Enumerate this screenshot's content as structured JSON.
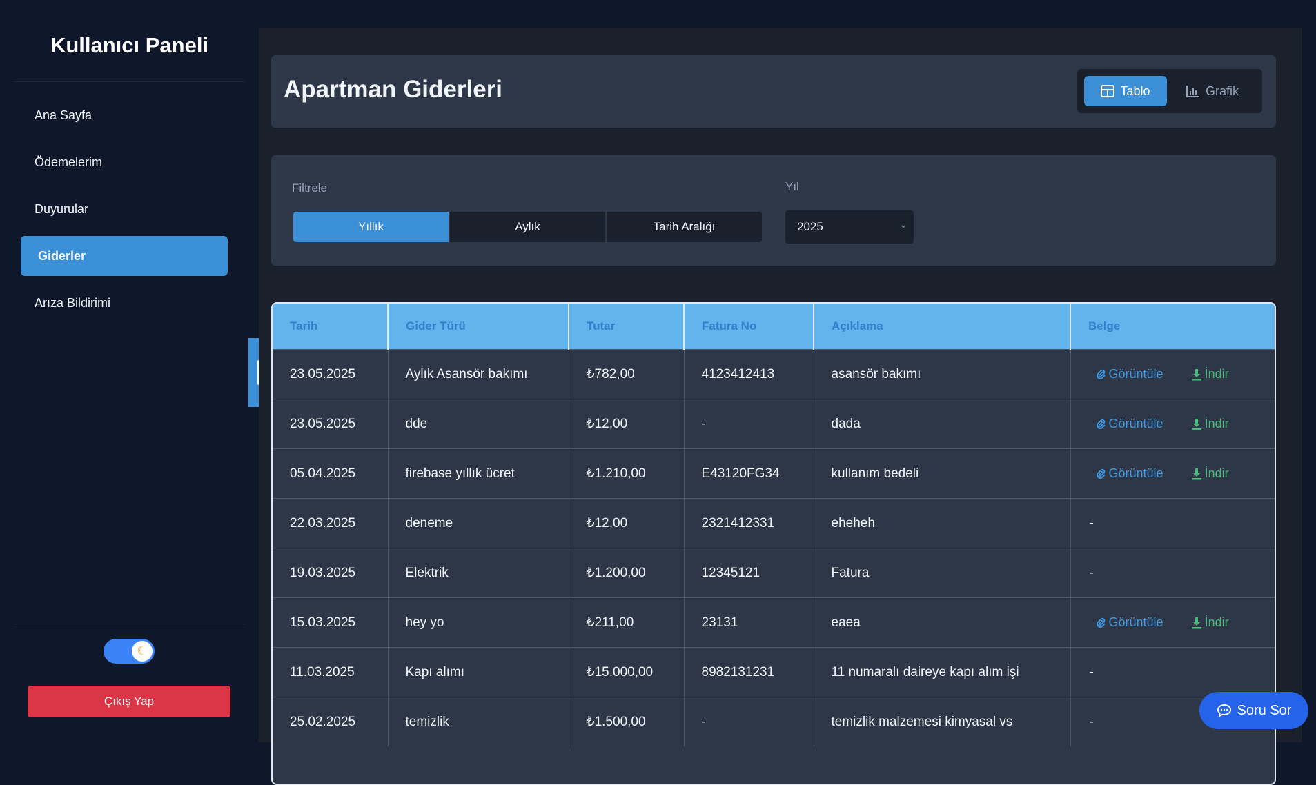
{
  "sidebar": {
    "title": "Kullanıcı Paneli",
    "items": [
      {
        "label": "Ana Sayfa",
        "active": false
      },
      {
        "label": "Ödemelerim",
        "active": false
      },
      {
        "label": "Duyurular",
        "active": false
      },
      {
        "label": "Giderler",
        "active": true
      },
      {
        "label": "Arıza Bildirimi",
        "active": false
      }
    ],
    "theme_toggle_icon": "moon-icon",
    "logout_label": "Çıkış Yap"
  },
  "header": {
    "title": "Apartman Giderleri",
    "view_table_label": "Tablo",
    "view_chart_label": "Grafik"
  },
  "filters": {
    "label": "Filtrele",
    "options": [
      "Yıllık",
      "Aylık",
      "Tarih Aralığı"
    ],
    "selected": "Yıllık",
    "year_label": "Yıl",
    "year_value": "2025"
  },
  "table": {
    "columns": [
      "Tarih",
      "Gider Türü",
      "Tutar",
      "Fatura No",
      "Açıklama",
      "Belge"
    ],
    "view_label": "Görüntüle",
    "download_label": "İndir",
    "rows": [
      {
        "date": "23.05.2025",
        "type": "Aylık Asansör bakımı",
        "amount": "₺782,00",
        "invoice": "4123412413",
        "desc": "asansör bakımı",
        "doc": true
      },
      {
        "date": "23.05.2025",
        "type": "dde",
        "amount": "₺12,00",
        "invoice": "-",
        "desc": "dada",
        "doc": true
      },
      {
        "date": "05.04.2025",
        "type": "firebase yıllık ücret",
        "amount": "₺1.210,00",
        "invoice": "E43120FG34",
        "desc": "kullanım bedeli",
        "doc": true
      },
      {
        "date": "22.03.2025",
        "type": "deneme",
        "amount": "₺12,00",
        "invoice": "2321412331",
        "desc": "eheheh",
        "doc": false
      },
      {
        "date": "19.03.2025",
        "type": "Elektrik",
        "amount": "₺1.200,00",
        "invoice": "12345121",
        "desc": "Fatura",
        "doc": false
      },
      {
        "date": "15.03.2025",
        "type": "hey yo",
        "amount": "₺211,00",
        "invoice": "23131",
        "desc": "eaea",
        "doc": true
      },
      {
        "date": "11.03.2025",
        "type": "Kapı alımı",
        "amount": "₺15.000,00",
        "invoice": "8982131231",
        "desc": "11 numaralı daireye kapı alım işi",
        "doc": false
      },
      {
        "date": "25.02.2025",
        "type": "temizlik",
        "amount": "₺1.500,00",
        "invoice": "-",
        "desc": "temizlik malzemesi kimyasal vs",
        "doc": false
      }
    ],
    "no_doc_text": "-"
  },
  "chat": {
    "label": "Soru Sor"
  },
  "colors": {
    "accent": "#3b8fd6",
    "danger": "#dc3545",
    "link": "#4299e1",
    "download": "#48bb78"
  }
}
